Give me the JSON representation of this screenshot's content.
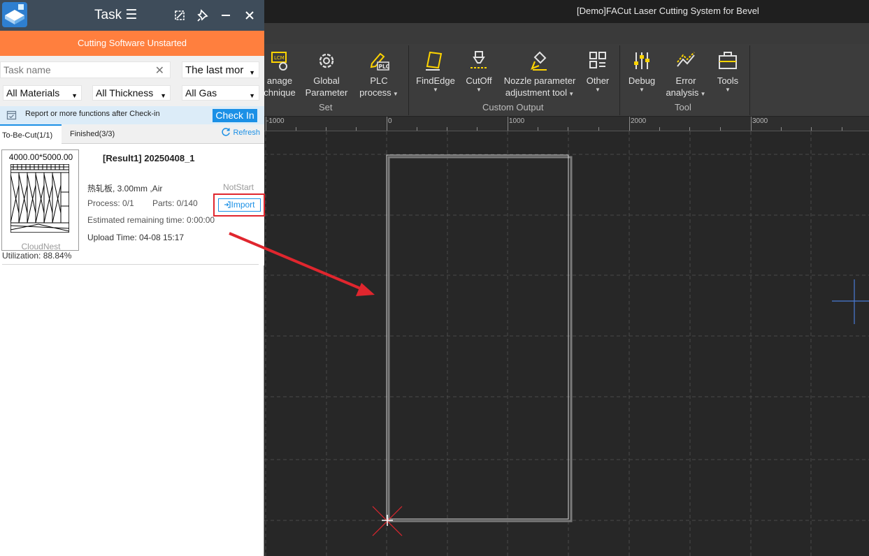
{
  "app": {
    "title": "[Demo]FACut Laser Cutting System for Bevel"
  },
  "ribbon": {
    "buttons": [
      {
        "label1": "anage",
        "label2": "chnique"
      },
      {
        "label1": "Global",
        "label2": "Parameter"
      },
      {
        "label1": "PLC",
        "label2": "process"
      },
      {
        "label1": "FindEdge"
      },
      {
        "label1": "CutOff"
      },
      {
        "label1": "Nozzle parameter",
        "label2": "adjustment tool"
      },
      {
        "label1": "Other"
      },
      {
        "label1": "Debug"
      },
      {
        "label1": "Error",
        "label2": "analysis"
      },
      {
        "label1": "Tools"
      }
    ],
    "groups": {
      "set": "Set",
      "custom": "Custom Output",
      "tool": "Tool"
    }
  },
  "ruler": {
    "labels": [
      "-1000",
      "0",
      "1000",
      "2000",
      "3000"
    ]
  },
  "task_panel": {
    "title": "Task ☰",
    "status": "Cutting Software Unstarted",
    "search": {
      "placeholder": "Task name"
    },
    "filters": {
      "time": "The last mor",
      "materials": "All Materials",
      "thickness": "All Thickness",
      "gas": "All Gas"
    },
    "notice": "Report or more functions after Check-in",
    "check_in": "Check In",
    "tabs": {
      "to_be_cut": "To-Be-Cut(1/1)",
      "finished": "Finished(3/3)"
    },
    "refresh": "Refresh",
    "task": {
      "dimensions": "4000.00*5000.00",
      "source": "CloudNest",
      "title": "[Result1] 20250408_1",
      "material_info": "热轧板, 3.00mm ,Air",
      "state": "NotStart",
      "process": "Process: 0/1",
      "parts": "Parts: 0/140",
      "import": "Import",
      "remaining": "Estimated remaining time: 0:00:00",
      "upload": "Upload Time: 04-08 15:17",
      "utilization": "Utilization: 88.84%"
    }
  },
  "colors": {
    "accent": "#1b90e6",
    "status_bg": "#ff7f3e",
    "highlight": "#e0262e",
    "icon_yellow": "#ffd400"
  }
}
